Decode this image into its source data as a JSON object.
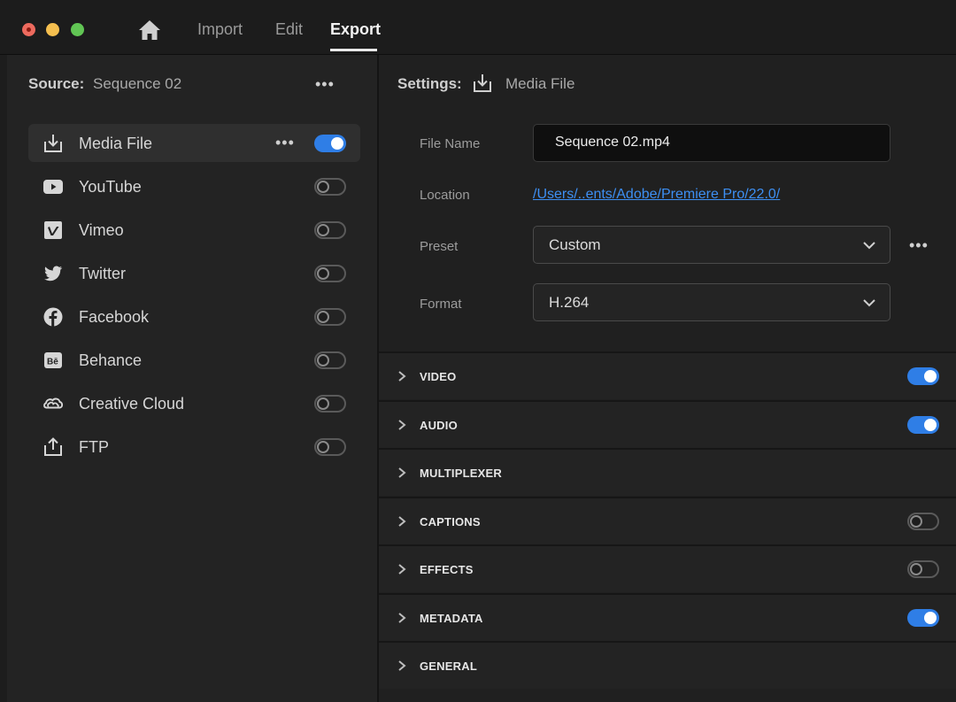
{
  "window": {
    "tabs": [
      {
        "label": "Import",
        "active": false
      },
      {
        "label": "Edit",
        "active": false
      },
      {
        "label": "Export",
        "active": true
      }
    ]
  },
  "source": {
    "label": "Source:",
    "value": "Sequence 02",
    "more": "•••"
  },
  "destinations": [
    {
      "label": "Media File",
      "icon": "download-icon",
      "enabled": true,
      "active": true,
      "more": "•••"
    },
    {
      "label": "YouTube",
      "icon": "youtube-icon",
      "enabled": false
    },
    {
      "label": "Vimeo",
      "icon": "vimeo-icon",
      "enabled": false
    },
    {
      "label": "Twitter",
      "icon": "twitter-icon",
      "enabled": false
    },
    {
      "label": "Facebook",
      "icon": "facebook-icon",
      "enabled": false
    },
    {
      "label": "Behance",
      "icon": "behance-icon",
      "enabled": false
    },
    {
      "label": "Creative Cloud",
      "icon": "creative-cloud-icon",
      "enabled": false
    },
    {
      "label": "FTP",
      "icon": "upload-icon",
      "enabled": false
    }
  ],
  "settings": {
    "label": "Settings:",
    "value": "Media File",
    "fields": {
      "file_name": {
        "label": "File Name",
        "value": "Sequence 02.mp4"
      },
      "location": {
        "label": "Location",
        "value": "/Users/..ents/Adobe/Premiere Pro/22.0/"
      },
      "preset": {
        "label": "Preset",
        "value": "Custom",
        "more": "•••"
      },
      "format": {
        "label": "Format",
        "value": "H.264"
      }
    },
    "sections": [
      {
        "title": "VIDEO",
        "toggle": "on"
      },
      {
        "title": "AUDIO",
        "toggle": "on"
      },
      {
        "title": "MULTIPLEXER",
        "toggle": "none"
      },
      {
        "title": "CAPTIONS",
        "toggle": "off"
      },
      {
        "title": "EFFECTS",
        "toggle": "off"
      },
      {
        "title": "METADATA",
        "toggle": "on"
      },
      {
        "title": "GENERAL",
        "toggle": "none"
      }
    ]
  },
  "colors": {
    "accent": "#2f7ee6",
    "link": "#3d8ff3",
    "close": "#ed6a5e",
    "minimize": "#f5bf4f",
    "zoom": "#61c554"
  }
}
